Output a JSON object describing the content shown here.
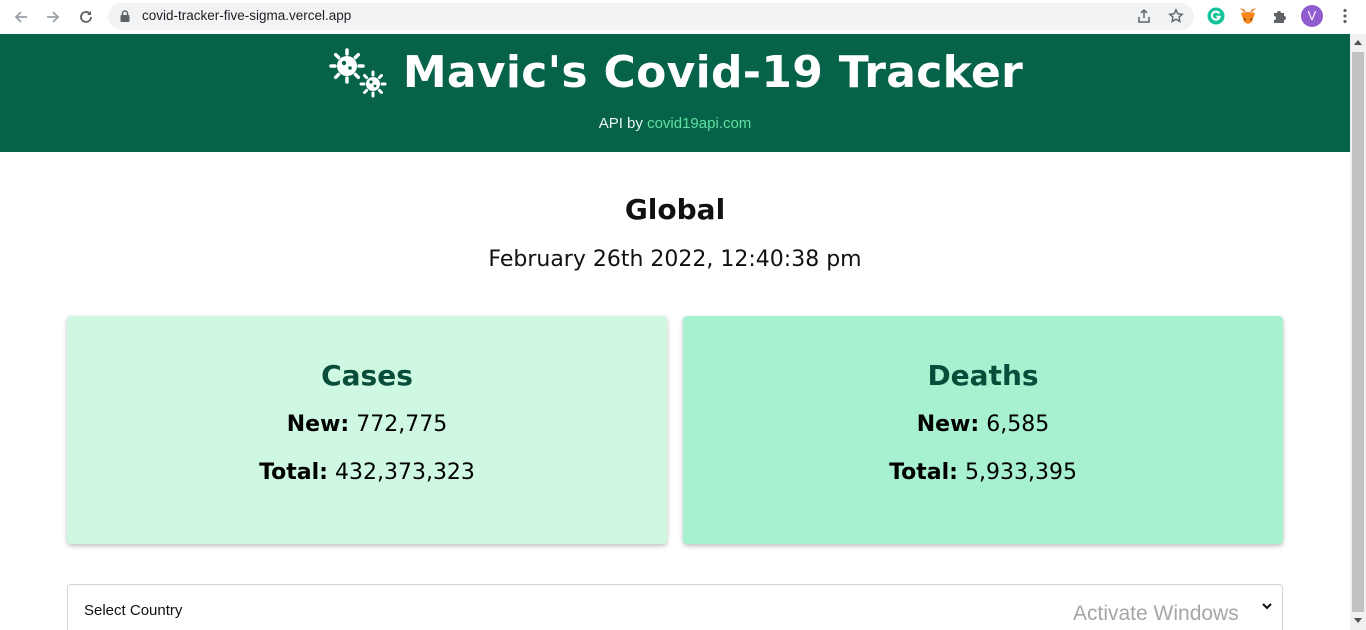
{
  "browser": {
    "url": "covid-tracker-five-sigma.vercel.app",
    "profile_initial": "V",
    "colors": {
      "profile": "#8e5ccf",
      "grammarly": "#15c39a"
    }
  },
  "header": {
    "title": "Mavic's Covid-19 Tracker",
    "subtitle_prefix": "API by",
    "subtitle_link": "covid19api.com",
    "icon": "virus-icon",
    "colors": {
      "background": "#06634a",
      "link": "#5ee0a0"
    }
  },
  "main": {
    "region": "Global",
    "timestamp": "February 26th 2022, 12:40:38 pm",
    "cards": [
      {
        "title": "Cases",
        "new_label": "New:",
        "new_value": "772,775",
        "total_label": "Total:",
        "total_value": "432,373,323",
        "color": "#cff8e3"
      },
      {
        "title": "Deaths",
        "new_label": "New:",
        "new_value": "6,585",
        "total_label": "Total:",
        "total_value": "5,933,395",
        "color": "#a7f1d1"
      }
    ],
    "select": {
      "selected": "Select Country"
    }
  },
  "os": {
    "watermark": "Activate Windows"
  }
}
